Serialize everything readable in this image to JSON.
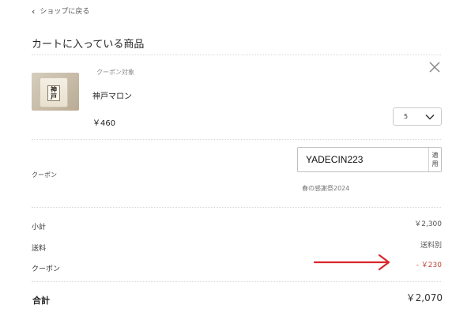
{
  "nav": {
    "back_label": "ショップに戻る"
  },
  "cart": {
    "title": "カートに入っている商品",
    "item": {
      "coupon_tag": "クーポン対象",
      "name": "神戸マロン",
      "price": "￥460",
      "quantity": "5",
      "package_label": "神戸マロン"
    }
  },
  "coupon": {
    "label": "クーポン",
    "code": "YADECIN223",
    "apply_label": "適用",
    "campaign": "春の感謝祭2024"
  },
  "summary": {
    "subtotal_label": "小計",
    "subtotal_value": "￥2,300",
    "shipping_label": "送料",
    "shipping_value": "送料別",
    "coupon_label": "クーポン",
    "coupon_value": "- ￥230",
    "total_label": "合計",
    "total_value": "￥2,070"
  },
  "colors": {
    "discount": "#c0463a",
    "arrow": "#d9262b"
  }
}
